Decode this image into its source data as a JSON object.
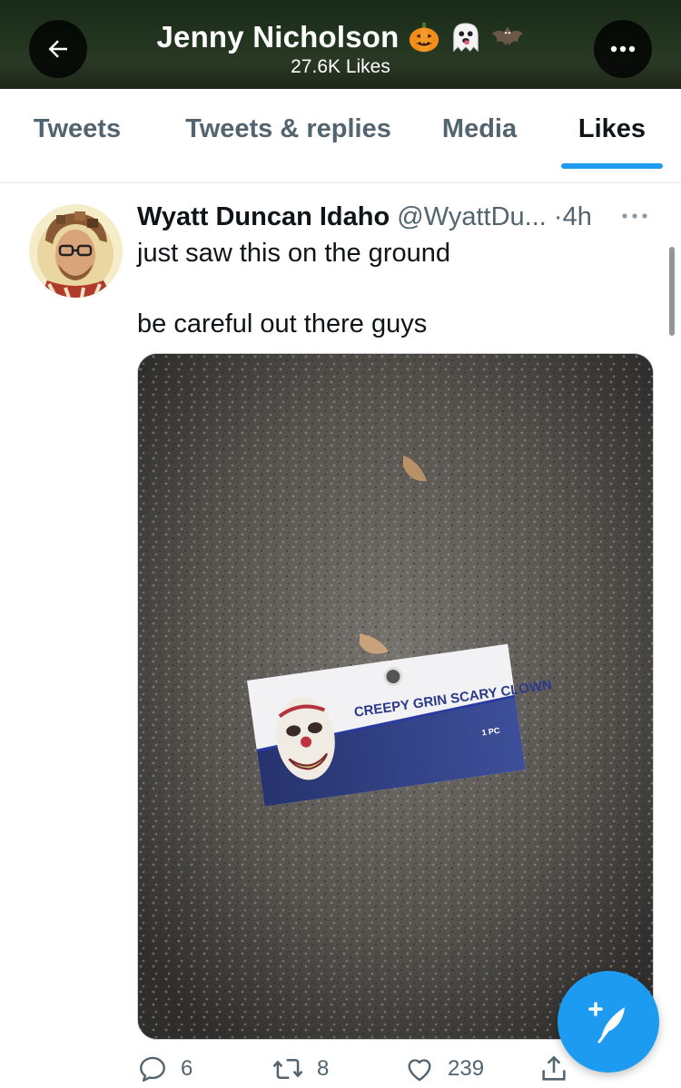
{
  "header": {
    "title": "Jenny Nicholson",
    "title_emojis": [
      "pumpkin-emoji",
      "ghost-emoji",
      "bat-emoji"
    ],
    "subtitle": "27.6K Likes",
    "back_icon": "arrow-left-icon",
    "more_icon": "more-horizontal-icon"
  },
  "tabs": [
    {
      "label": "Tweets",
      "active": false
    },
    {
      "label": "Tweets & replies",
      "active": false
    },
    {
      "label": "Media",
      "active": false
    },
    {
      "label": "Likes",
      "active": true
    }
  ],
  "tweet": {
    "author_name": "Wyatt Duncan Idaho",
    "handle": "@WyattDu...",
    "separator": "·",
    "time": "4h",
    "text_line1": "just saw this on the ground",
    "text_line2": "be careful out there guys",
    "media": {
      "package_text": "CREEPY GRIN SCARY CLOWN",
      "package_count": "1 PC"
    },
    "actions": {
      "replies": "6",
      "retweets": "8",
      "likes": "239"
    }
  },
  "colors": {
    "accent": "#1d9bf0",
    "secondary_text": "#536471",
    "primary_text": "#0f1419"
  }
}
